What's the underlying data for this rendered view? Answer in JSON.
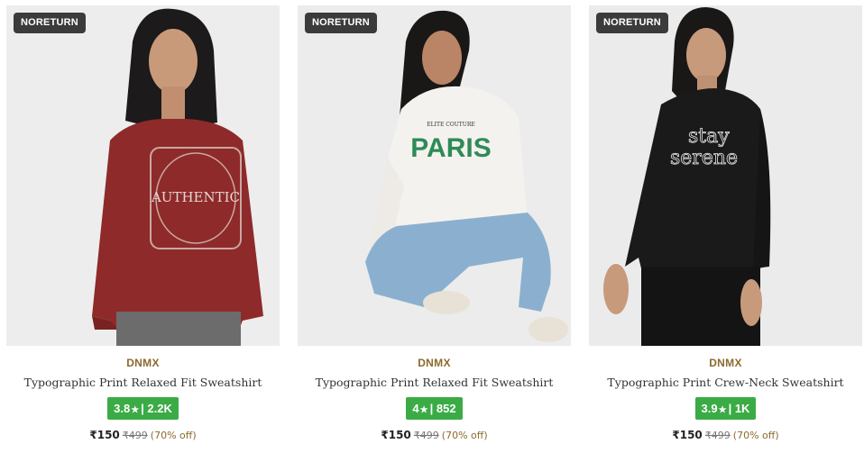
{
  "products": [
    {
      "badge": "NORETURN",
      "brand": "DNMX",
      "title": "Typographic Print Relaxed Fit Sweatshirt",
      "rating": "3.8",
      "rating_count": "2.2K",
      "price": "₹150",
      "mrp": "₹499",
      "discount": "(70% off)",
      "image": {
        "icon": "product-photo",
        "garment_color": "#8e2a2a",
        "print_text": "AUTHENTIC"
      }
    },
    {
      "badge": "NORETURN",
      "brand": "DNMX",
      "title": "Typographic Print Relaxed Fit Sweatshirt",
      "rating": "4",
      "rating_count": "852",
      "price": "₹150",
      "mrp": "₹499",
      "discount": "(70% off)",
      "image": {
        "icon": "product-photo",
        "garment_color": "#f4f2ee",
        "print_text": "PARIS"
      }
    },
    {
      "badge": "NORETURN",
      "brand": "DNMX",
      "title": "Typographic Print Crew-Neck Sweatshirt",
      "rating": "3.9",
      "rating_count": "1K",
      "price": "₹150",
      "mrp": "₹499",
      "discount": "(70% off)",
      "image": {
        "icon": "product-photo",
        "garment_color": "#1a1a1a",
        "print_text": "stay serene"
      }
    }
  ],
  "colors": {
    "badge_bg": "#3b3b3b",
    "rating_bg": "#3bab46",
    "brand": "#8b6a2e",
    "star_icon": "star-icon"
  }
}
